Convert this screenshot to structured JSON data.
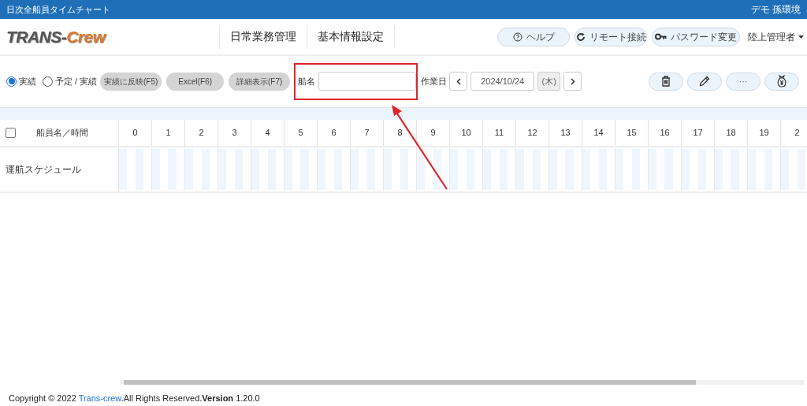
{
  "title_bar": {
    "title": "日次全船員タイムチャート",
    "environment": "デモ 孫環境"
  },
  "header": {
    "logo": {
      "part_1": "TRANS-",
      "part_2": "Crew"
    },
    "nav": [
      "日常業務管理",
      "基本情報設定"
    ],
    "buttons": [
      {
        "kind": "help",
        "label": "ヘルプ"
      },
      {
        "kind": "remote",
        "label": "リモート接続"
      },
      {
        "kind": "password",
        "label": "パスワード変更"
      }
    ],
    "user": "陸上管理者"
  },
  "toolbar": {
    "modes": [
      {
        "label": "実績",
        "selected": true
      },
      {
        "label": "予定 / 実績",
        "selected": false
      }
    ],
    "actions": [
      "実績に反映(F5)",
      "Excel(F6)",
      "詳細表示(F7)"
    ],
    "ship_label": "船名",
    "work_date_label": "作業日",
    "date": "2024/10/24",
    "weekday": "(木)",
    "icon_buttons": [
      {
        "kind": "trash"
      },
      {
        "kind": "pencil"
      },
      {
        "kind": "more",
        "label": "···"
      },
      {
        "kind": "money-bag"
      }
    ]
  },
  "table": {
    "select_all": {
      "checked": false
    },
    "name_header": "船員名／時間",
    "hours": [
      "0",
      "1",
      "2",
      "3",
      "4",
      "5",
      "6",
      "7",
      "8",
      "9",
      "10",
      "11",
      "12",
      "13",
      "14",
      "15",
      "16",
      "17",
      "18",
      "19",
      "2"
    ],
    "rows": [
      {
        "name": "運航スケジュール"
      }
    ]
  },
  "footer": {
    "before": "Copyright © 2022 ",
    "link": "Trans-crew",
    "after": ".All Rights Reserved.**Version** 1.20.0"
  }
}
